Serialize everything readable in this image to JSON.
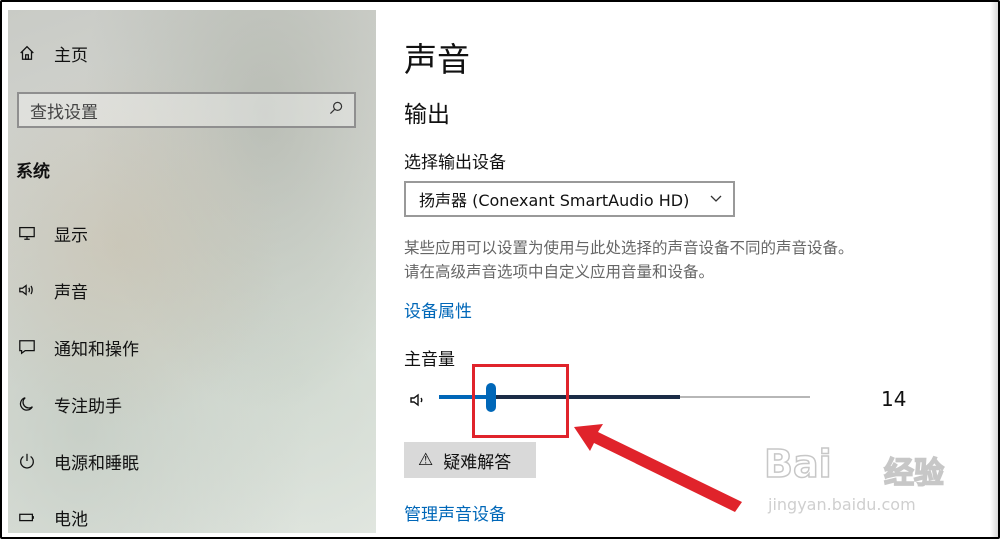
{
  "sidebar": {
    "home_label": "主页",
    "search_placeholder": "查找设置",
    "section_title": "系统",
    "items": [
      {
        "label": "显示",
        "icon": "monitor-icon"
      },
      {
        "label": "声音",
        "icon": "speaker-icon"
      },
      {
        "label": "通知和操作",
        "icon": "notification-icon"
      },
      {
        "label": "专注助手",
        "icon": "moon-icon"
      },
      {
        "label": "电源和睡眠",
        "icon": "power-icon"
      },
      {
        "label": "电池",
        "icon": "battery-icon"
      }
    ]
  },
  "main": {
    "title": "声音",
    "output_heading": "输出",
    "output_device_label": "选择输出设备",
    "output_device_value": "扬声器 (Conexant SmartAudio HD)",
    "description_line1": "某些应用可以设置为使用与此处选择的声音设备不同的声音设备。",
    "description_line2": "请在高级声音选项中自定义应用音量和设备。",
    "device_properties_link": "设备属性",
    "master_volume_label": "主音量",
    "volume_value": "14",
    "volume_level": 0.14,
    "volume_peak_level": 0.65,
    "troubleshoot_label": "疑难解答",
    "manage_devices_link": "管理声音设备"
  },
  "watermark": {
    "brand": "Bai",
    "brand_cn": "经验",
    "url": "jingyan.baidu.com"
  },
  "colors": {
    "accent": "#0067b8",
    "annotation": "#e0232b"
  }
}
